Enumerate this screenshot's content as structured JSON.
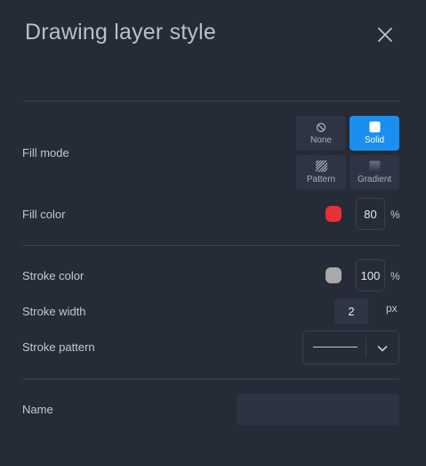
{
  "dialog": {
    "title": "Drawing layer style",
    "close_icon": "close-icon"
  },
  "fill_mode": {
    "label": "Fill mode",
    "options": [
      {
        "label": "None",
        "icon": "none-icon",
        "active": false
      },
      {
        "label": "Solid",
        "icon": "solid-square-icon",
        "active": true
      },
      {
        "label": "Pattern",
        "icon": "pattern-hatch-icon",
        "active": false
      },
      {
        "label": "Gradient",
        "icon": "gradient-icon",
        "active": false
      }
    ]
  },
  "fill_color": {
    "label": "Fill color",
    "color": "#e83035",
    "opacity": "80",
    "unit": "%"
  },
  "stroke_color": {
    "label": "Stroke color",
    "color": "#a9a9a9",
    "opacity": "100",
    "unit": "%"
  },
  "stroke_width": {
    "label": "Stroke width",
    "value": "2",
    "unit": "px"
  },
  "stroke_pattern": {
    "label": "Stroke pattern",
    "selected": "solid-line"
  },
  "name": {
    "label": "Name",
    "value": "",
    "placeholder": ""
  },
  "colors": {
    "background": "#262b38",
    "accent": "#1b8fef",
    "button": "#2e3443"
  }
}
